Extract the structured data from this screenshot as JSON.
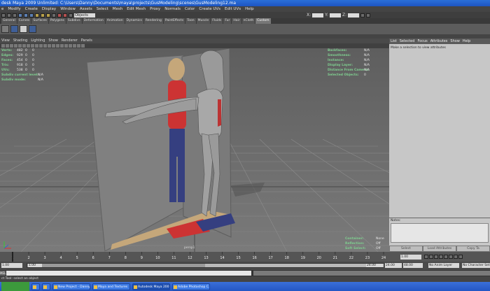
{
  "window": {
    "title": "desk Maya 2009 Unlimited: C:\\Users\\Danny\\Documents\\maya\\projects\\GusModeling\\scenes\\GusModeling12.ma"
  },
  "menubar": [
    "e",
    "Modify",
    "Create",
    "Display",
    "Window",
    "Assets",
    "Select",
    "Mesh",
    "Edit Mesh",
    "Proxy",
    "Normals",
    "Color",
    "Create UVs",
    "Edit UVs",
    "Help"
  ],
  "statusline": {
    "object_field": "Objects",
    "x_label": "X:",
    "y_label": "Y:",
    "z_label": "Z:"
  },
  "shelf_tabs": [
    "General",
    "Curves",
    "Surfaces",
    "Polygons",
    "Subdivs",
    "Deformation",
    "Animation",
    "Dynamics",
    "Rendering",
    "PaintEffects",
    "Toon",
    "Muscle",
    "Fluids",
    "Fur",
    "Hair",
    "nCloth",
    "Custom"
  ],
  "shelf_active_tab": "Custom",
  "panel_menu": [
    "View",
    "Shading",
    "Lighting",
    "Show",
    "Renderer",
    "Panels"
  ],
  "hud_left": [
    {
      "label": "Verts:",
      "v1": "482",
      "v2": "0",
      "v3": "0"
    },
    {
      "label": "Edges:",
      "v1": "929",
      "v2": "0",
      "v3": "0"
    },
    {
      "label": "Faces:",
      "v1": "454",
      "v2": "0",
      "v3": "0"
    },
    {
      "label": "Tris:",
      "v1": "918",
      "v2": "0",
      "v3": "0"
    },
    {
      "label": "UVs:",
      "v1": "538",
      "v2": "0",
      "v3": "0"
    },
    {
      "label": "Subdiv current level:",
      "v1": "N/A",
      "v2": "",
      "v3": ""
    },
    {
      "label": "Subdiv mode:",
      "v1": "N/A",
      "v2": "",
      "v3": ""
    }
  ],
  "hud_right": [
    {
      "label": "Backfaces:",
      "value": "N/A"
    },
    {
      "label": "Smoothness:",
      "value": "N/A"
    },
    {
      "label": "Instance:",
      "value": "N/A"
    },
    {
      "label": "Display Layer:",
      "value": "N/A"
    },
    {
      "label": "Distance From Camera:",
      "value": "N/A"
    },
    {
      "label": "Selected Objects:",
      "value": "0"
    }
  ],
  "hud_bottom": [
    {
      "label": "Container:",
      "value": "None"
    },
    {
      "label": "Reflection:",
      "value": "Off"
    },
    {
      "label": "Soft Select:",
      "value": "Off"
    }
  ],
  "camera_label": "persp1",
  "right_panel": {
    "menu": [
      "List",
      "Selected",
      "Focus",
      "Attributes",
      "Show",
      "Help"
    ],
    "message": "Make a selection to view attributes",
    "notes_label": "Notes:",
    "buttons": [
      "Select",
      "Load Attributes",
      "Copy Ta"
    ]
  },
  "timeline": {
    "ticks": [
      "1",
      "2",
      "3",
      "4",
      "5",
      "6",
      "7",
      "8",
      "9",
      "10",
      "11",
      "12",
      "13",
      "14",
      "15",
      "16",
      "17",
      "18",
      "19",
      "20",
      "21",
      "22",
      "23",
      "24"
    ],
    "current_frame": "1.00"
  },
  "range": {
    "start": "1.00",
    "inner_start": "1.00",
    "inner_end": "24.00",
    "end": "24.00",
    "end2": "48.00",
    "anim_layer": "No Anim Layer",
    "char_set": "No Character Set"
  },
  "cmdline": {
    "mel": "MEL"
  },
  "helpline": "ct Tool: select an object",
  "taskbar": [
    {
      "label": "New Project - Danny...",
      "active": false
    },
    {
      "label": "Maya and Textures",
      "active": false
    },
    {
      "label": "Autodesk Maya 200...",
      "active": true
    },
    {
      "label": "Adobe Photoshop C...",
      "active": false
    }
  ],
  "colors": {
    "hud_label": "#7fcf90",
    "title_blue": "#2b6fd8",
    "viewport_bg": "#6c6c6c"
  }
}
